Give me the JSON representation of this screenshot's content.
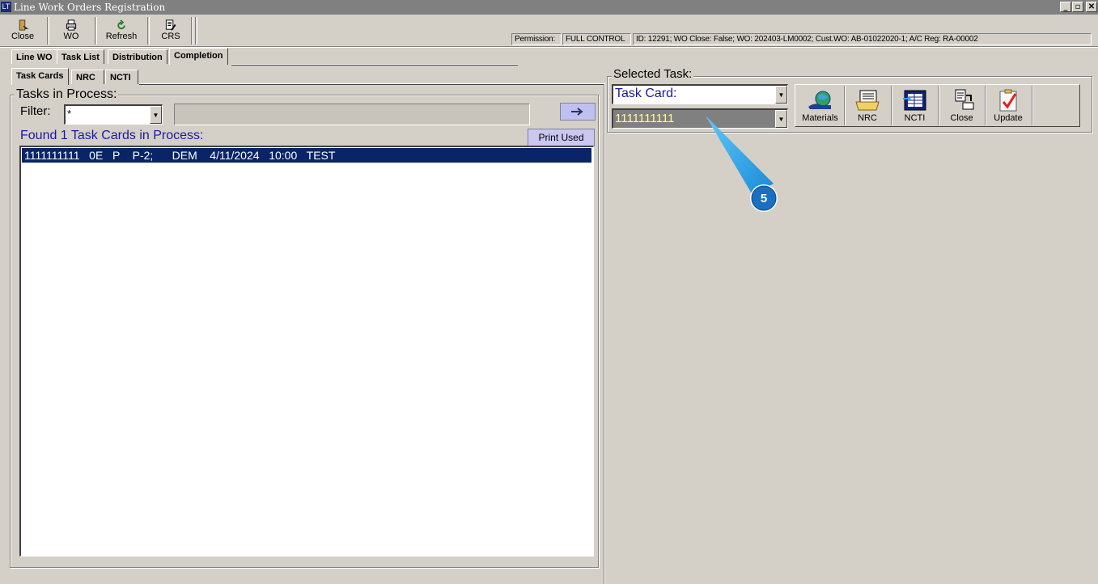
{
  "window": {
    "title": "Line Work Orders Registration",
    "app_icon_text": "LT",
    "controls": {
      "minimize": "_",
      "restore": "▫",
      "close": "✕"
    }
  },
  "toolbar": {
    "buttons": [
      {
        "label": "Close",
        "icon": "door-exit-icon"
      },
      {
        "label": "WO",
        "icon": "printer-icon"
      },
      {
        "label": "Refresh",
        "icon": "refresh-icon"
      },
      {
        "label": "CRS",
        "icon": "document-edit-icon"
      }
    ]
  },
  "status": {
    "permission_label": "Permission:",
    "permission_value": "FULL CONTROL",
    "info": "ID: 12291; WO Close: False; WO: 202403-LM0002; Cust.WO: AB-01022020-1; A/C Reg: RA-00002"
  },
  "main_tabs": [
    {
      "label": "Line WO",
      "active": false
    },
    {
      "label": "Task List",
      "active": false
    },
    {
      "label": "Distribution",
      "active": false
    },
    {
      "label": "Completion",
      "active": true
    }
  ],
  "sub_tabs": [
    {
      "label": "Task Cards",
      "active": true
    },
    {
      "label": "NRC",
      "active": false
    },
    {
      "label": "NCTI",
      "active": false
    }
  ],
  "tasks_panel": {
    "title": "Tasks in Process:",
    "filter_label": "Filter:",
    "filter_value": "*",
    "go_icon": "arrow-right-icon",
    "found_text": "Found 1 Task Cards in Process:",
    "print_used_label": "Print Used",
    "rows": [
      {
        "text": "1111111111   0E   P    P-2;      DEM    4/11/2024   10:00   TEST",
        "selected": true
      }
    ]
  },
  "selected_task": {
    "title": "Selected Task:",
    "type_value": "Task Card:",
    "card_value": "1111111111",
    "buttons": [
      {
        "label": "Materials",
        "icon": "globe-hand-icon"
      },
      {
        "label": "NRC",
        "icon": "documents-icon"
      },
      {
        "label": "NCTI",
        "icon": "table-icon"
      },
      {
        "label": "Close",
        "icon": "document-close-icon"
      },
      {
        "label": "Update",
        "icon": "clipboard-check-icon"
      }
    ]
  },
  "callout": {
    "number": "5",
    "color": "#2a9fe0"
  }
}
